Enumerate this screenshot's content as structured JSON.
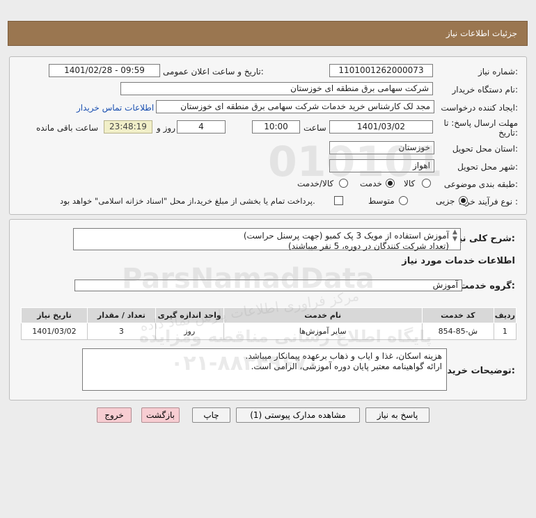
{
  "header": {
    "title": "جزئیات اطلاعات نیاز"
  },
  "need_info": {
    "need_number_label": "شماره نیاز:",
    "need_number": "1101001262000073",
    "announce_label": "تاریخ و ساعت اعلان عمومی:",
    "announce_value": "1401/02/28 - 09:59",
    "buyer_org_label": "نام دستگاه خریدار:",
    "buyer_org": "شرکت سهامی برق منطقه ای خوزستان",
    "requester_label": "ایجاد کننده درخواست:",
    "requester": "مجد لک کارشناس خرید خدمات شرکت سهامی برق منطقه ای خوزستان",
    "contact_link": "اطلاعات تماس خریدار",
    "deadline_label_1": "مهلت ارسال پاسخ: تا",
    "deadline_label_2": "تاریخ:",
    "deadline_date": "1401/03/02",
    "time_label": "ساعت",
    "deadline_time": "10:00",
    "days_value": "4",
    "days_label": "روز و",
    "remaining_time": "23:48:19",
    "remaining_label": "ساعت باقی مانده",
    "province_label": "استان محل تحویل:",
    "province": "خوزستان",
    "city_label": "شهر محل تحویل:",
    "city": "اهواز",
    "category_label": "طبقه بندی موضوعی:",
    "category_options": [
      "کالا",
      "خدمت",
      "کالا/خدمت"
    ],
    "category_selected": "خدمت",
    "process_label": "نوع فرآیند خرید :",
    "process_options": [
      "جزیی",
      "متوسط"
    ],
    "process_selected": "جزیی",
    "treasury_note": "پرداخت تمام یا بخشی از مبلغ خرید،از محل \"اسناد خزانه اسلامی\" خواهد بود."
  },
  "general_desc": {
    "label": "شرح کلی نیاز:",
    "line1": "آموزش استفاده از مویک 3 پک کمبو (جهت پرسنل حراست)",
    "line2": "(تعداد شرکت کنندگان در دوره،   5 نفر میباشند)"
  },
  "services": {
    "section_title": "اطلاعات خدمات مورد نیاز",
    "group_label": "گروه خدمت:",
    "group_value": "آموزش",
    "columns": [
      "ردیف",
      "کد خدمت",
      "نام خدمت",
      "واحد اندازه گیری",
      "تعداد / مقدار",
      "تاریخ نیاز"
    ],
    "rows": [
      [
        "1",
        "ش-85-854",
        "سایر آموزش‌ها",
        "روز",
        "3",
        "1401/03/02"
      ]
    ]
  },
  "buyer_notes": {
    "label": "توضیحات خریدار:",
    "line1": "هزینه اسکان، غذا و ایاب و ذهاب برعهده پیمانکار میباشد.",
    "line2": "ارائه گواهینامه معتبر پایان دوره آموزشی، الزامی است."
  },
  "buttons": {
    "reply": "پاسخ به نیاز",
    "view_docs": "مشاهده مدارک پیوستی (1)",
    "print": "چاپ",
    "back": "بازگشت",
    "exit": "خروج"
  },
  "watermark": {
    "brand": "ParsNamadData",
    "subtitle": "مرکز فراوری اطلاعات پارس نماد داده",
    "subtitle2": "پایگاه اطلاع رسانی مناقصه ومزایده",
    "phone": "۰۲۱-۸۸۳۴۹۶۷۰",
    "number": "010101"
  },
  "colors": {
    "header_bg": "#9a7650",
    "remaining_bg": "#f1efc8",
    "exit_bg": "#f7cdd2",
    "link": "#1a4fb0"
  }
}
